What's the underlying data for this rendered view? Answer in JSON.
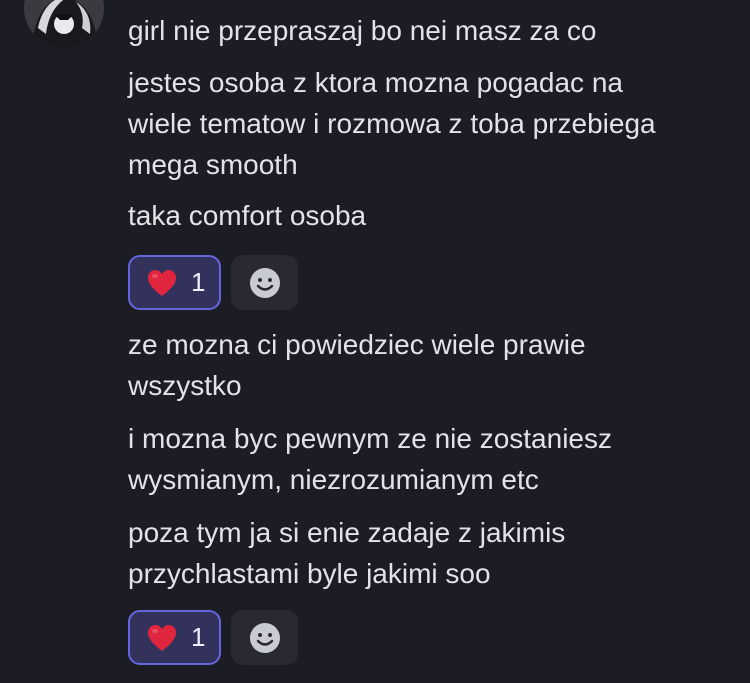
{
  "messages": [
    "girl nie przepraszaj bo nei masz za co",
    "jestes osoba z ktora mozna pogadac na\nwiele tematow i rozmowa z toba przebiega\nmega smooth",
    "taka comfort osoba",
    "ze mozna ci powiedziec wiele prawie\nwszystko",
    "i mozna byc pewnym ze nie zostaniesz\nwysmianym, niezrozumianym etc",
    "poza tym ja si enie zadaje z jakimis\nprzychlastami byle jakimi soo"
  ],
  "reactions": [
    {
      "emoji": "heart-emoji-icon",
      "count": "1",
      "active": true
    },
    {
      "emoji": "heart-emoji-icon",
      "count": "1",
      "active": true
    }
  ],
  "colors": {
    "background": "#1c1c24",
    "text": "#e2e3e9",
    "reaction_bg": "#32325c",
    "reaction_border": "#6366dd",
    "heart": "#e0263f",
    "add_reaction_bg": "#292933"
  }
}
